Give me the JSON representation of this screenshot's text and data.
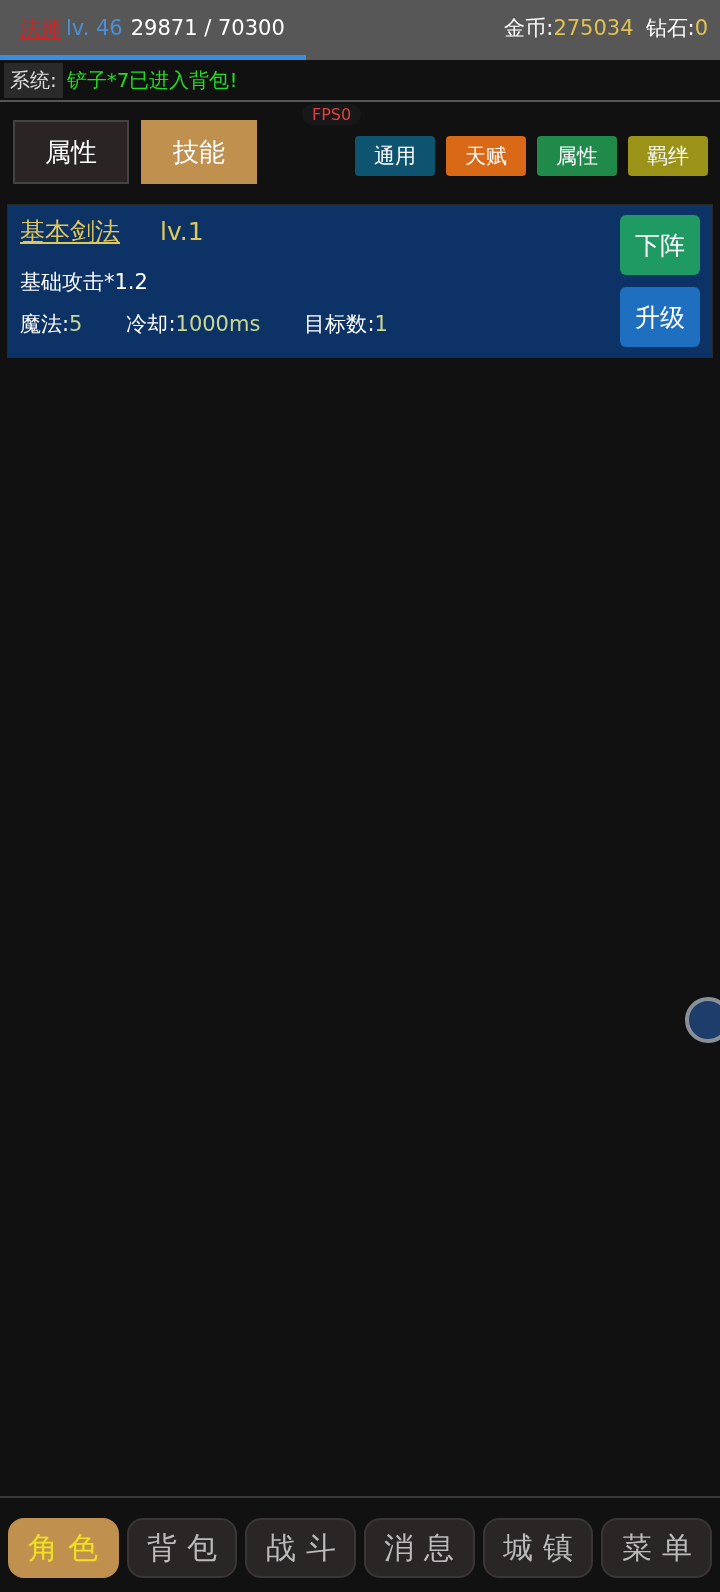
{
  "header": {
    "class_name": "法师",
    "level": "lv. 46",
    "exp": "29871 / 70300",
    "exp_bar": {
      "level": 0.425
    },
    "gold_label": "金币:",
    "gold": "275034",
    "diamond_label": "钻石:",
    "diamond": "0"
  },
  "system": {
    "label": "系统:",
    "message": "铲子*7已进入背包!"
  },
  "fps": "FPS0",
  "tabs": [
    {
      "label": "属性",
      "selected": false
    },
    {
      "label": "技能",
      "selected": true
    }
  ],
  "filters": [
    {
      "label": "通用",
      "color": "#0e5470"
    },
    {
      "label": "天赋",
      "color": "#d96916"
    },
    {
      "label": "属性",
      "color": "#1f8a4a"
    },
    {
      "label": "羁绊",
      "color": "#9a9318"
    }
  ],
  "skills": [
    {
      "name": "基本剑法",
      "level": "lv.1",
      "description": "基础攻击*1.2",
      "stats": [
        {
          "label": "魔法:",
          "value": "5"
        },
        {
          "label": "冷却:",
          "value": "1000ms"
        },
        {
          "label": "目标数:",
          "value": "1"
        }
      ],
      "buttons": [
        {
          "label": "下阵",
          "kind": "unequip"
        },
        {
          "label": "升级",
          "kind": "upgrade"
        }
      ]
    }
  ],
  "nav": [
    {
      "label": "角色",
      "selected": true
    },
    {
      "label": "背包",
      "selected": false
    },
    {
      "label": "战斗",
      "selected": false
    },
    {
      "label": "消息",
      "selected": false
    },
    {
      "label": "城镇",
      "selected": false
    },
    {
      "label": "菜单",
      "selected": false
    }
  ]
}
